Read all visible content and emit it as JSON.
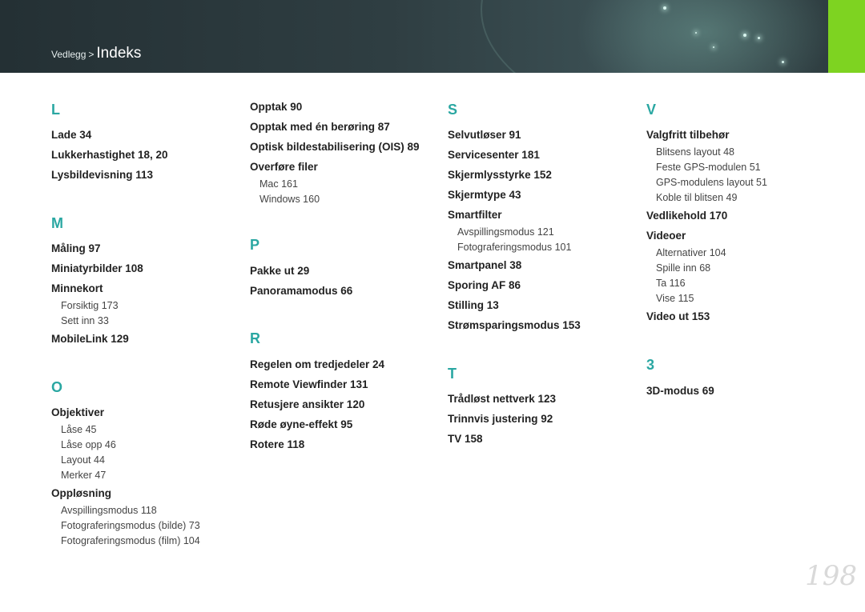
{
  "breadcrumb": {
    "parent": "Vedlegg",
    "separator": ">",
    "current": "Indeks"
  },
  "page_number": "198",
  "columns": [
    {
      "sections": [
        {
          "letter": "L",
          "entries": [
            {
              "label": "Lade  34",
              "subs": []
            },
            {
              "label": "Lukkerhastighet  18, 20",
              "subs": []
            },
            {
              "label": "Lysbildevisning  113",
              "subs": []
            }
          ]
        },
        {
          "letter": "M",
          "entries": [
            {
              "label": "Måling  97",
              "subs": []
            },
            {
              "label": "Miniatyrbilder  108",
              "subs": []
            },
            {
              "label": "Minnekort",
              "subs": [
                "Forsiktig  173",
                "Sett inn  33"
              ]
            },
            {
              "label": "MobileLink  129",
              "subs": []
            }
          ]
        },
        {
          "letter": "O",
          "entries": [
            {
              "label": "Objektiver",
              "subs": [
                "Låse  45",
                "Låse opp  46",
                "Layout  44",
                "Merker  47"
              ]
            },
            {
              "label": "Oppløsning",
              "subs": [
                "Avspillingsmodus  118",
                "Fotograferingsmodus (bilde)  73",
                "Fotograferingsmodus (film)  104"
              ]
            }
          ]
        }
      ]
    },
    {
      "sections": [
        {
          "letter": "",
          "entries": [
            {
              "label": "Opptak  90",
              "subs": []
            },
            {
              "label": "Opptak med én berøring  87",
              "subs": []
            },
            {
              "label": "Optisk bildestabilisering (OIS)  89",
              "subs": []
            },
            {
              "label": "Overføre filer",
              "subs": [
                "Mac  161",
                "Windows  160"
              ]
            }
          ]
        },
        {
          "letter": "P",
          "entries": [
            {
              "label": "Pakke ut  29",
              "subs": []
            },
            {
              "label": "Panoramamodus  66",
              "subs": []
            }
          ]
        },
        {
          "letter": "R",
          "entries": [
            {
              "label": "Regelen om tredjedeler  24",
              "subs": []
            },
            {
              "label": "Remote Viewfinder  131",
              "subs": []
            },
            {
              "label": "Retusjere ansikter  120",
              "subs": []
            },
            {
              "label": "Røde øyne-effekt  95",
              "subs": []
            },
            {
              "label": "Rotere  118",
              "subs": []
            }
          ]
        }
      ]
    },
    {
      "sections": [
        {
          "letter": "S",
          "entries": [
            {
              "label": "Selvutløser  91",
              "subs": []
            },
            {
              "label": "Servicesenter  181",
              "subs": []
            },
            {
              "label": "Skjermlysstyrke  152",
              "subs": []
            },
            {
              "label": "Skjermtype  43",
              "subs": []
            },
            {
              "label": "Smartfilter",
              "subs": [
                "Avspillingsmodus  121",
                "Fotograferingsmodus  101"
              ]
            },
            {
              "label": "Smartpanel  38",
              "subs": []
            },
            {
              "label": "Sporing AF  86",
              "subs": []
            },
            {
              "label": "Stilling  13",
              "subs": []
            },
            {
              "label": "Strømsparingsmodus  153",
              "subs": []
            }
          ]
        },
        {
          "letter": "T",
          "entries": [
            {
              "label": "Trådløst nettverk  123",
              "subs": []
            },
            {
              "label": "Trinnvis justering  92",
              "subs": []
            },
            {
              "label": "TV  158",
              "subs": []
            }
          ]
        }
      ]
    },
    {
      "sections": [
        {
          "letter": "V",
          "entries": [
            {
              "label": "Valgfritt tilbehør",
              "subs": [
                "Blitsens layout  48",
                "Feste GPS-modulen  51",
                "GPS-modulens layout  51",
                "Koble til blitsen  49"
              ]
            },
            {
              "label": "Vedlikehold  170",
              "subs": []
            },
            {
              "label": "Videoer",
              "subs": [
                "Alternativer  104",
                "Spille inn  68",
                "Ta  116",
                "Vise  115"
              ]
            },
            {
              "label": "Video ut  153",
              "subs": []
            }
          ]
        },
        {
          "letter": "3",
          "entries": [
            {
              "label": "3D-modus  69",
              "subs": []
            }
          ]
        }
      ]
    }
  ]
}
